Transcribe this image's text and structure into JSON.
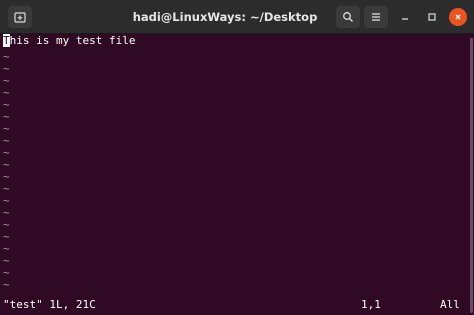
{
  "titlebar": {
    "title": "hadi@LinuxWays: ~/Desktop",
    "icons": {
      "new_tab": "new-tab-icon",
      "search": "search-icon",
      "menu": "hamburger-menu-icon",
      "minimize": "minimize-icon",
      "maximize": "maximize-icon",
      "close": "close-icon"
    }
  },
  "editor": {
    "first_char": "T",
    "first_line_rest": "his is my test file",
    "tilde": "~",
    "status_file": "\"test\" 1L, 21C",
    "status_position": "1,1",
    "status_scroll": "All"
  },
  "colors": {
    "terminal_bg": "#300a24",
    "titlebar_bg": "#2c2c2c",
    "close_button": "#e95420"
  }
}
